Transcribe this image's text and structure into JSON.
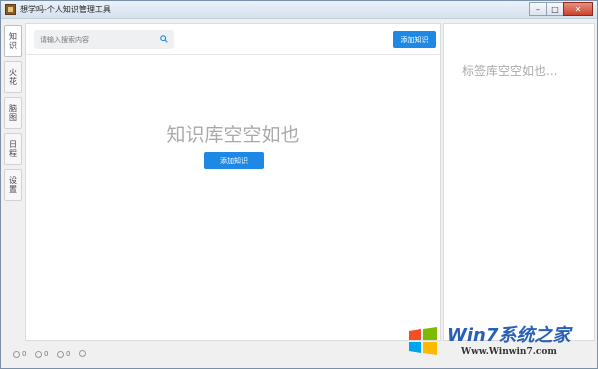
{
  "window": {
    "title": "想学吗-个人知识管理工具"
  },
  "sidebar": {
    "tabs": [
      {
        "label": "知识"
      },
      {
        "label": "火花"
      },
      {
        "label": "脑图"
      },
      {
        "label": "日程"
      },
      {
        "label": "设置"
      }
    ]
  },
  "main": {
    "search_placeholder": "请输入搜索内容",
    "add_button_top": "添加知识",
    "empty_text": "知识库空空如也",
    "add_button_center": "添加知识"
  },
  "right_panel": {
    "empty_text": "标签库空空如也..."
  },
  "status": {
    "items": [
      "0",
      "0",
      "0"
    ]
  },
  "watermark": {
    "brand": "Win7系统之家",
    "url": "Www.Winwin7.com"
  },
  "colors": {
    "accent": "#1e88e5",
    "placeholder_text": "#aaaaaa"
  }
}
